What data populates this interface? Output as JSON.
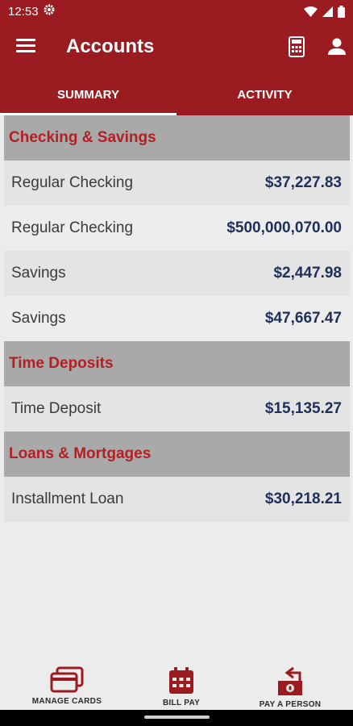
{
  "status": {
    "time": "12:53"
  },
  "header": {
    "title": "Accounts"
  },
  "tabs": [
    {
      "label": "SUMMARY",
      "active": true
    },
    {
      "label": "ACTIVITY",
      "active": false
    }
  ],
  "sections": [
    {
      "title": "Checking & Savings",
      "accounts": [
        {
          "name": "Regular Checking",
          "amount": "$37,227.83"
        },
        {
          "name": "Regular Checking",
          "amount": "$500,000,070.00"
        },
        {
          "name": "Savings",
          "amount": "$2,447.98"
        },
        {
          "name": "Savings",
          "amount": "$47,667.47"
        }
      ]
    },
    {
      "title": "Time Deposits",
      "accounts": [
        {
          "name": "Time Deposit",
          "amount": "$15,135.27"
        }
      ]
    },
    {
      "title": "Loans & Mortgages",
      "accounts": [
        {
          "name": "Installment Loan",
          "amount": "$30,218.21"
        }
      ]
    }
  ],
  "bottom_nav": [
    {
      "label": "MANAGE CARDS",
      "icon": "credit-card-icon"
    },
    {
      "label": "BILL PAY",
      "icon": "calendar-icon"
    },
    {
      "label": "PAY A PERSON",
      "icon": "money-transfer-icon"
    }
  ],
  "colors": {
    "brand": "#9a1c20",
    "section_text": "#b32024",
    "amount_text": "#1f2f5a",
    "section_bg": "#a9a9a9"
  }
}
